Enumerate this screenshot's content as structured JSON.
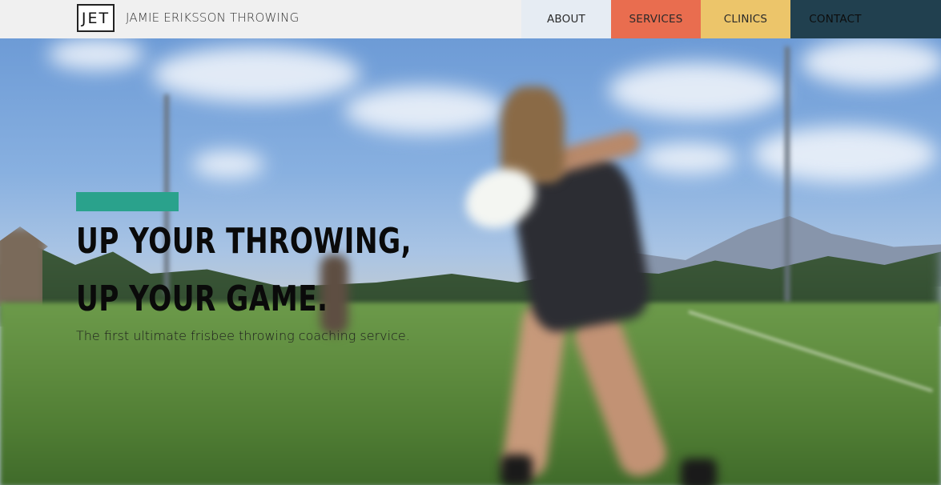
{
  "header": {
    "logo_text": "JET",
    "site_name": "JAMIE ERIKSSON THROWING",
    "nav": [
      {
        "label": "ABOUT",
        "color": "#e6ecf3"
      },
      {
        "label": "SERVICES",
        "color": "#e96d4f"
      },
      {
        "label": "CLINICS",
        "color": "#ecc56a"
      },
      {
        "label": "CONTACT",
        "color": "#21404f"
      }
    ]
  },
  "hero": {
    "headline_line1": "UP YOUR THROWING,",
    "headline_line2": "UP YOUR GAME.",
    "tagline": "The first ultimate frisbee throwing coaching service.",
    "accent_color": "#2aa28c",
    "background_image": "blurred-photo-frisbee-thrower-on-field"
  }
}
